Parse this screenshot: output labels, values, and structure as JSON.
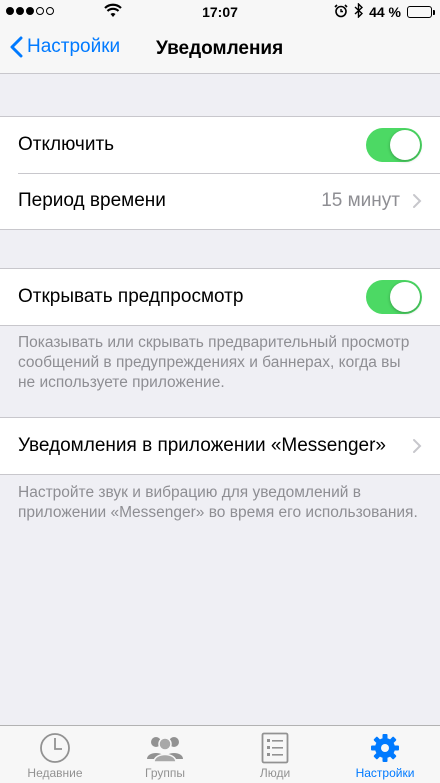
{
  "status_bar": {
    "time": "17:07",
    "battery": "44 %",
    "battery_level": 0.44,
    "signal_bars_filled": 3,
    "signal_bars_total": 5
  },
  "nav": {
    "back_label": "Настройки",
    "title": "Уведомления"
  },
  "section1": {
    "disable_label": "Отключить",
    "disable_on": true,
    "period_label": "Период времени",
    "period_value": "15 минут"
  },
  "section2": {
    "preview_label": "Открывать предпросмотр",
    "preview_on": true,
    "preview_footnote": "Показывать или скрывать предварительный просмотр сообщений в предупреждениях и баннерах, когда вы не используете приложение."
  },
  "section3": {
    "inapp_label": "Уведомления в приложении «Messenger»",
    "inapp_footnote": "Настройте звук и вибрацию для уведомлений в приложении «Messenger» во время его использования."
  },
  "tab_bar": {
    "tabs": [
      {
        "label": "Недавние",
        "icon": "clock-icon",
        "active": false
      },
      {
        "label": "Группы",
        "icon": "groups-icon",
        "active": false
      },
      {
        "label": "Люди",
        "icon": "people-list-icon",
        "active": false
      },
      {
        "label": "Настройки",
        "icon": "gear-icon",
        "active": true
      }
    ]
  },
  "colors": {
    "accent": "#007aff",
    "toggle_on": "#4cd964",
    "background": "#efeff4",
    "secondary_text": "#8e8e93"
  }
}
